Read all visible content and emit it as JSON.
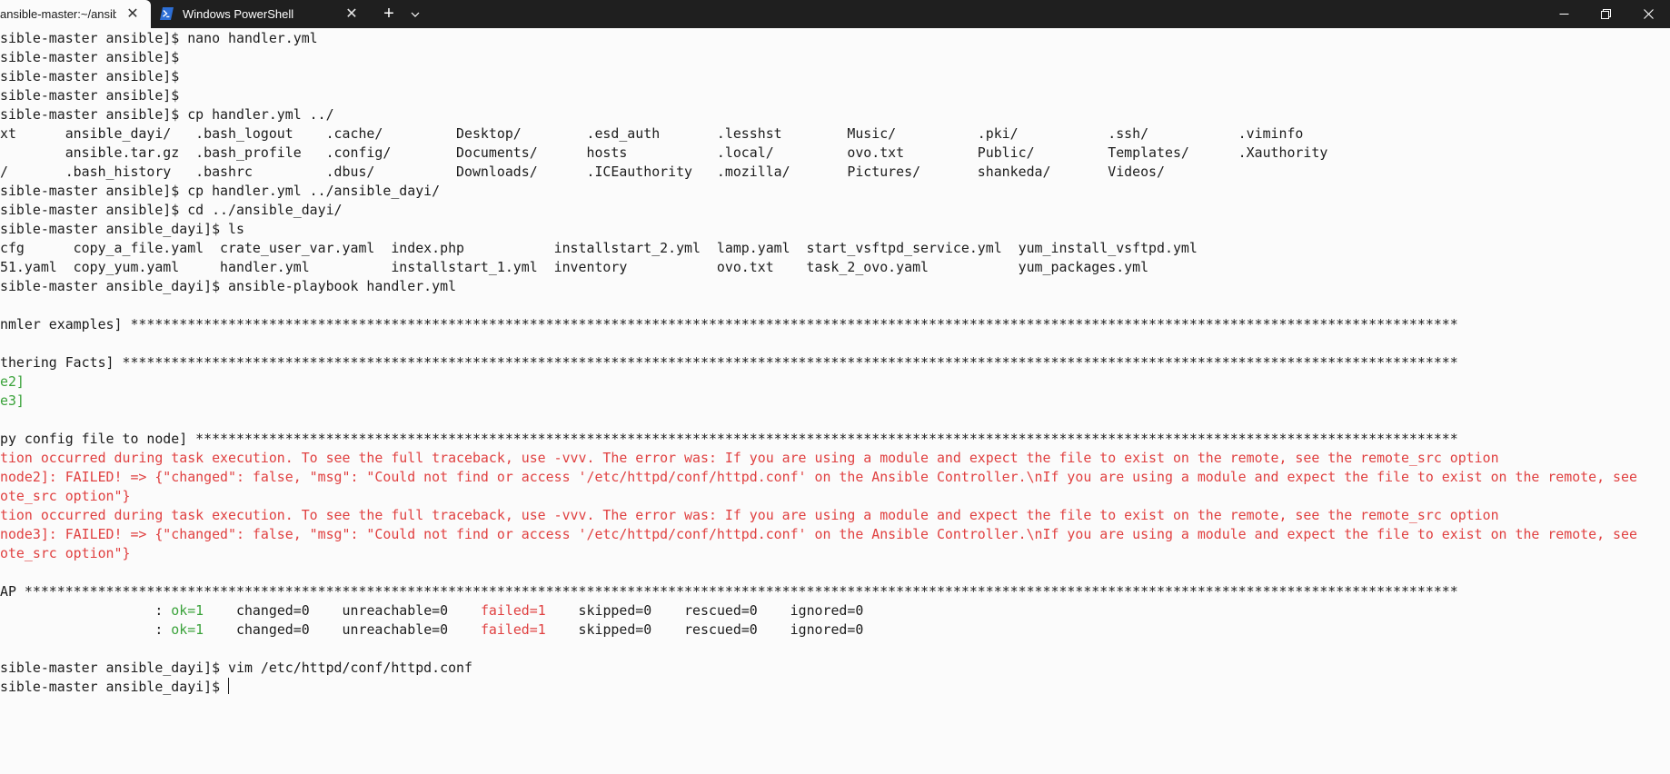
{
  "window": {
    "tabs": [
      {
        "label": "ansible-master:~/ansible",
        "close_glyph": "✕",
        "active": true
      },
      {
        "label": "Windows PowerShell",
        "icon": "powershell-icon",
        "close_glyph": "✕",
        "active": false
      }
    ],
    "new_tab_glyph": "+",
    "dropdown_icon": "chevron-down-icon",
    "controls": [
      "minimize-icon",
      "maximize-icon",
      "close-icon"
    ]
  },
  "colors": {
    "title_bar": "#1f1f1f",
    "terminal_background": "#fbfbfb",
    "terminal_text": "#1c1c1c",
    "error_red": "#e04040",
    "ok_green": "#3aa23a"
  },
  "terminal": {
    "lines": [
      {
        "segments": [
          {
            "text": "sible-master ansible]$ nano handler.yml"
          }
        ]
      },
      {
        "segments": [
          {
            "text": "sible-master ansible]$"
          }
        ]
      },
      {
        "segments": [
          {
            "text": "sible-master ansible]$"
          }
        ]
      },
      {
        "segments": [
          {
            "text": "sible-master ansible]$"
          }
        ]
      },
      {
        "segments": [
          {
            "text": "sible-master ansible]$ cp handler.yml ../"
          }
        ]
      },
      {
        "segments": [
          {
            "text": "xt      ansible_dayi/   .bash_logout    .cache/         Desktop/        .esd_auth       .lesshst        Music/          .pki/           .ssh/           .viminfo"
          }
        ]
      },
      {
        "segments": [
          {
            "text": "        ansible.tar.gz  .bash_profile   .config/        Documents/      hosts           .local/         ovo.txt         Public/         Templates/      .Xauthority"
          }
        ]
      },
      {
        "segments": [
          {
            "text": "/       .bash_history   .bashrc         .dbus/          Downloads/      .ICEauthority   .mozilla/       Pictures/       shankeda/       Videos/"
          }
        ]
      },
      {
        "segments": [
          {
            "text": "sible-master ansible]$ cp handler.yml ../ansible_dayi/"
          }
        ]
      },
      {
        "segments": [
          {
            "text": "sible-master ansible]$ cd ../ansible_dayi/"
          }
        ]
      },
      {
        "segments": [
          {
            "text": "sible-master ansible_dayi]$ ls"
          }
        ]
      },
      {
        "segments": [
          {
            "text": "cfg      copy_a_file.yaml  crate_user_var.yaml  index.php           installstart_2.yml  lamp.yaml  start_vsftpd_service.yml  yum_install_vsftpd.yml"
          }
        ]
      },
      {
        "segments": [
          {
            "text": "51.yaml  copy_yum.yaml     handler.yml          installstart_1.yml  inventory           ovo.txt    task_2_ovo.yaml           yum_packages.yml"
          }
        ]
      },
      {
        "segments": [
          {
            "text": "sible-master ansible_dayi]$ ansible-playbook handler.yml"
          }
        ]
      },
      {
        "segments": []
      },
      {
        "segments": [
          {
            "text": "nmler examples] *******************************************************************************************************************************************************************"
          }
        ]
      },
      {
        "segments": []
      },
      {
        "segments": [
          {
            "text": "thering Facts] ********************************************************************************************************************************************************************"
          }
        ]
      },
      {
        "segments": [
          {
            "text": "e2]",
            "color": "green"
          }
        ]
      },
      {
        "segments": [
          {
            "text": "e3]",
            "color": "green"
          }
        ]
      },
      {
        "segments": []
      },
      {
        "segments": [
          {
            "text": "py config file to node] ***********************************************************************************************************************************************************"
          }
        ]
      },
      {
        "segments": [
          {
            "text": "tion occurred during task execution. To see the full traceback, use -vvv. The error was: If you are using a module and expect the file to exist on the remote, see the remote_src option",
            "color": "red"
          }
        ]
      },
      {
        "segments": [
          {
            "text": "node2]: FAILED! => {\"changed\": false, \"msg\": \"Could not find or access '/etc/httpd/conf/httpd.conf' on the Ansible Controller.\\nIf you are using a module and expect the file to exist on the remote, see",
            "color": "red"
          }
        ]
      },
      {
        "segments": [
          {
            "text": "ote_src option\"}",
            "color": "red"
          }
        ]
      },
      {
        "segments": [
          {
            "text": "tion occurred during task execution. To see the full traceback, use -vvv. The error was: If you are using a module and expect the file to exist on the remote, see the remote_src option",
            "color": "red"
          }
        ]
      },
      {
        "segments": [
          {
            "text": "node3]: FAILED! => {\"changed\": false, \"msg\": \"Could not find or access '/etc/httpd/conf/httpd.conf' on the Ansible Controller.\\nIf you are using a module and expect the file to exist on the remote, see",
            "color": "red"
          }
        ]
      },
      {
        "segments": [
          {
            "text": "ote_src option\"}",
            "color": "red"
          }
        ]
      },
      {
        "segments": []
      },
      {
        "segments": [
          {
            "text": "AP ********************************************************************************************************************************************************************************"
          }
        ]
      },
      {
        "segments": [
          {
            "text": "                   : "
          },
          {
            "text": "ok=1",
            "color": "green"
          },
          {
            "text": "    changed=0    unreachable=0    "
          },
          {
            "text": "failed=1",
            "color": "red"
          },
          {
            "text": "    skipped=0    rescued=0    ignored=0"
          }
        ]
      },
      {
        "segments": [
          {
            "text": "                   : "
          },
          {
            "text": "ok=1",
            "color": "green"
          },
          {
            "text": "    changed=0    unreachable=0    "
          },
          {
            "text": "failed=1",
            "color": "red"
          },
          {
            "text": "    skipped=0    rescued=0    ignored=0"
          }
        ]
      },
      {
        "segments": []
      },
      {
        "segments": [
          {
            "text": "sible-master ansible_dayi]$ vim /etc/httpd/conf/httpd.conf"
          }
        ]
      },
      {
        "segments": [
          {
            "text": "sible-master ansible_dayi]$ "
          }
        ],
        "cursor": true
      }
    ]
  }
}
